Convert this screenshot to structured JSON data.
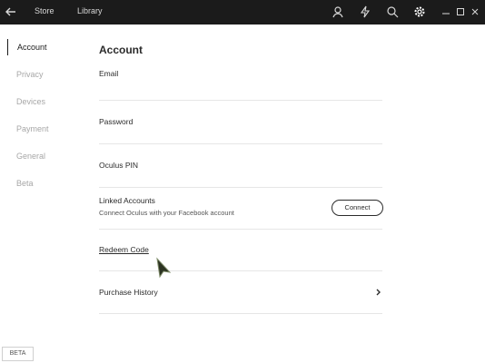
{
  "topbar": {
    "nav": [
      "Store",
      "Library"
    ],
    "icons": [
      "user-icon",
      "bolt-icon",
      "search-icon",
      "gear-icon",
      "minimize-icon",
      "maximize-icon",
      "close-icon"
    ]
  },
  "sidebar": {
    "items": [
      {
        "label": "Account",
        "active": true
      },
      {
        "label": "Privacy"
      },
      {
        "label": "Devices"
      },
      {
        "label": "Payment"
      },
      {
        "label": "General"
      },
      {
        "label": "Beta"
      }
    ]
  },
  "main": {
    "title": "Account",
    "rows": {
      "email": "Email",
      "password": "Password",
      "pin": "Oculus PIN",
      "linked": "Linked Accounts",
      "linked_sub": "Connect Oculus with your Facebook account",
      "connect": "Connect",
      "redeem": "Redeem Code",
      "history": "Purchase History"
    }
  },
  "footer": {
    "beta": "BETA"
  }
}
